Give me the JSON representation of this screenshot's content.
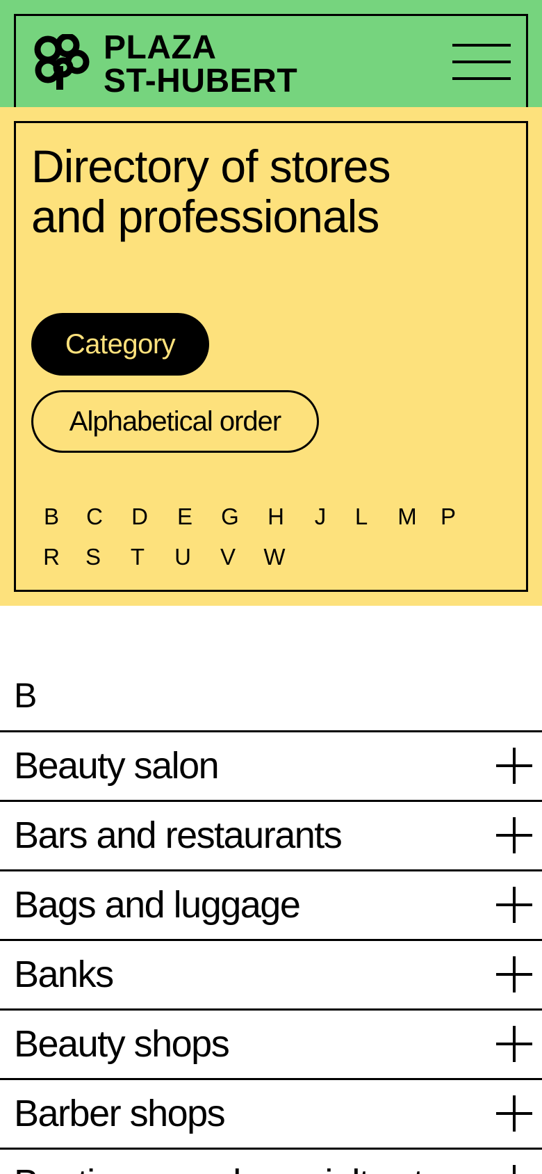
{
  "brand": {
    "line1": "PLAZA",
    "line2": "ST-HUBERT",
    "logo": "tree-logo-icon",
    "menu_icon": "hamburger-menu-icon"
  },
  "colors": {
    "header_green": "#76d47e",
    "section_yellow": "#fde17c",
    "ink": "#000000"
  },
  "intro": {
    "title_line1": "Directory of stores",
    "title_line2": "and professionals",
    "sort_category": "Category",
    "sort_alpha": "Alphabetical order",
    "letters": [
      "B",
      "C",
      "D",
      "E",
      "G",
      "H",
      "J",
      "L",
      "M",
      "P",
      "R",
      "S",
      "T",
      "U",
      "V",
      "W"
    ]
  },
  "list": {
    "section_letter": "B",
    "items": [
      "Beauty salon",
      "Bars and restaurants",
      "Bags and luggage",
      "Banks",
      "Beauty shops",
      "Barber shops",
      "Boutiques and specialty stores"
    ]
  }
}
